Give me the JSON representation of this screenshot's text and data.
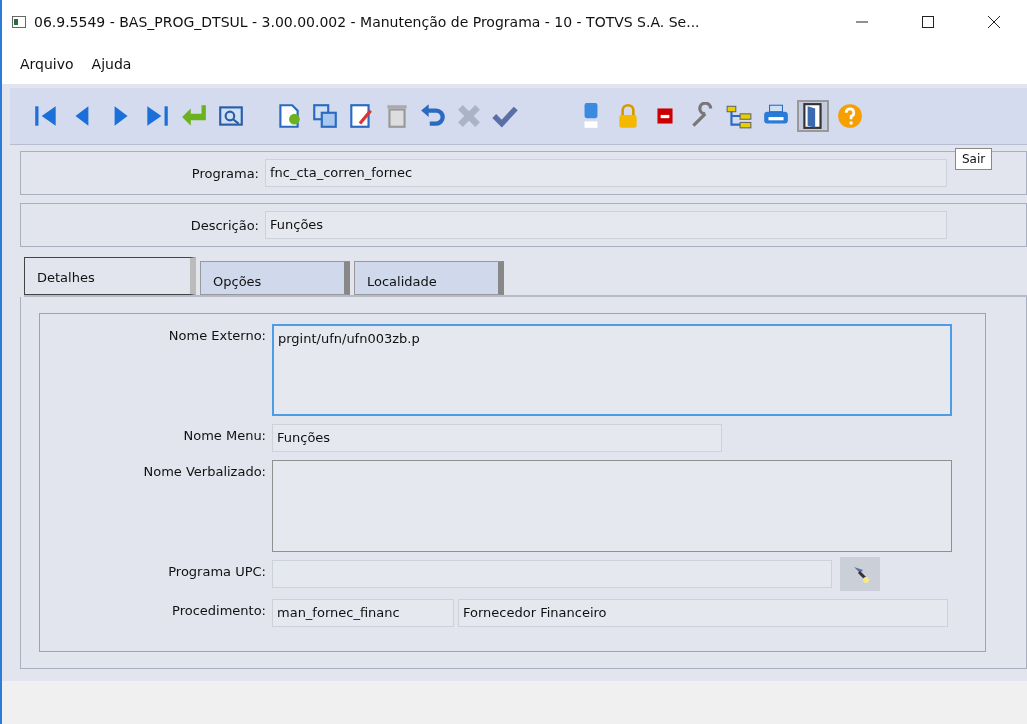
{
  "window": {
    "title": "06.9.5549 - BAS_PROG_DTSUL - 3.00.00.002 - Manutenção de Programa - 10 - TOTVS S.A. Se..."
  },
  "menu": [
    "Arquivo",
    "Ajuda"
  ],
  "tooltip": "Sair",
  "header_fields": [
    {
      "label": "Programa:",
      "value": "fnc_cta_corren_fornec"
    },
    {
      "label": "Descrição:",
      "value": "Funções"
    }
  ],
  "tabs": [
    {
      "label": "Detalhes",
      "selected": true
    },
    {
      "label": "Opções",
      "selected": false
    },
    {
      "label": "Localidade",
      "selected": false
    }
  ],
  "details": [
    {
      "label": "Nome Externo:",
      "kind": "textarea",
      "value": "prgint/ufn/ufn003zb.p",
      "focused": true
    },
    {
      "label": "Nome Menu:",
      "kind": "short",
      "value": "Funções"
    },
    {
      "label": "Nome Verbalizado:",
      "kind": "textarea",
      "focused": false
    },
    {
      "label": "Programa UPC:",
      "kind": "lookup"
    },
    {
      "label": "Procedimento:",
      "kind": "pair",
      "values": [
        "man_fornec_financ",
        "Fornecedor Financeiro"
      ]
    }
  ]
}
